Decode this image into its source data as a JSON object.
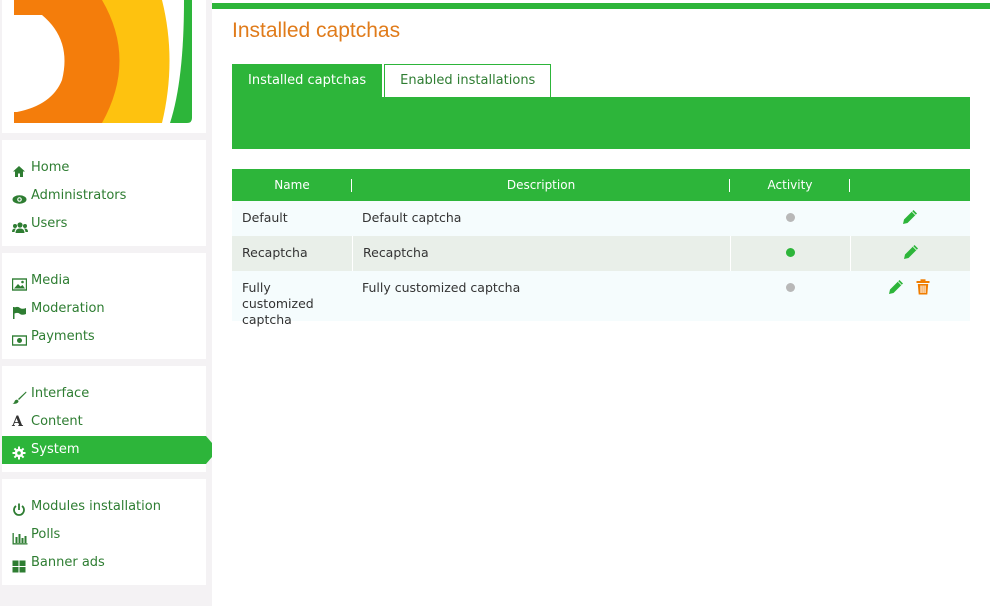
{
  "sidebar": {
    "groups": [
      {
        "items": [
          {
            "label": "Home",
            "icon": "home-icon"
          },
          {
            "label": "Administrators",
            "icon": "eye-icon"
          },
          {
            "label": "Users",
            "icon": "users-icon"
          }
        ]
      },
      {
        "items": [
          {
            "label": "Media",
            "icon": "image-icon"
          },
          {
            "label": "Moderation",
            "icon": "flag-icon"
          },
          {
            "label": "Payments",
            "icon": "money-icon"
          }
        ]
      },
      {
        "items": [
          {
            "label": "Interface",
            "icon": "brush-icon"
          },
          {
            "label": "Content",
            "icon": "font-icon"
          },
          {
            "label": "System",
            "icon": "gear-icon",
            "active": true
          }
        ]
      },
      {
        "items": [
          {
            "label": "Modules installation",
            "icon": "power-icon"
          },
          {
            "label": "Polls",
            "icon": "bar-chart-icon"
          },
          {
            "label": "Banner ads",
            "icon": "grid-icon"
          }
        ]
      }
    ]
  },
  "main": {
    "title": "Installed captchas",
    "tabs": [
      {
        "label": "Installed captchas",
        "active": true
      },
      {
        "label": "Enabled installations",
        "active": false
      }
    ],
    "table": {
      "columns": [
        "Name",
        "Description",
        "Activity",
        ""
      ],
      "rows": [
        {
          "name": "Default",
          "description": "Default captcha",
          "active": false,
          "actions": [
            "edit-icon"
          ]
        },
        {
          "name": "Recaptcha",
          "description": "Recaptcha",
          "active": true,
          "actions": [
            "edit-icon"
          ]
        },
        {
          "name": "Fully customized captcha",
          "description": "Fully customized captcha",
          "active": false,
          "actions": [
            "edit-icon",
            "trash-icon"
          ]
        }
      ]
    }
  },
  "colors": {
    "accent": "#2db53a",
    "title": "#e07b1a",
    "active_dot": "#2db53a",
    "inactive_dot": "#b8b8b8",
    "delete": "#f07d00"
  }
}
